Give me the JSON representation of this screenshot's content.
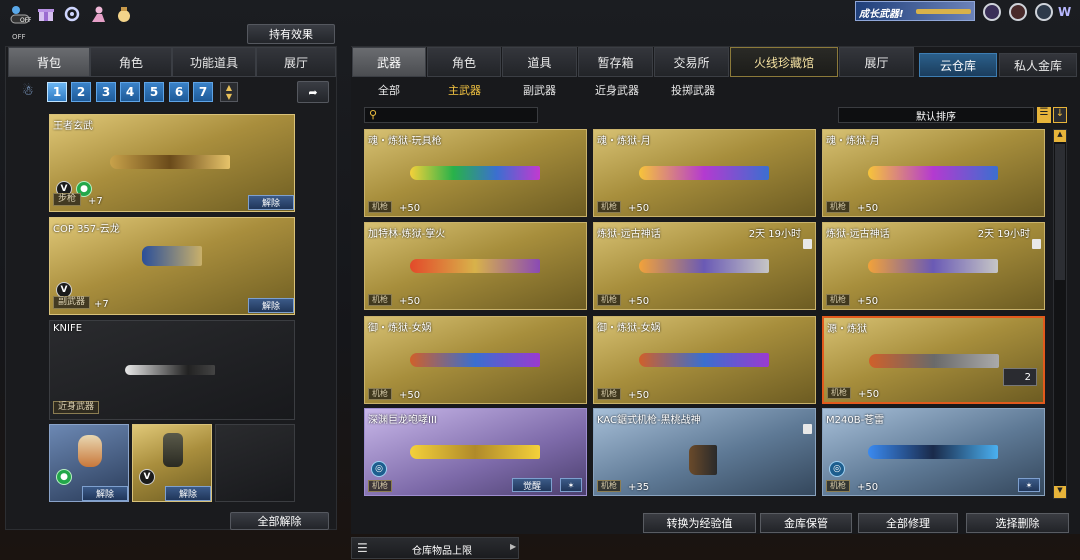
{
  "top_icons": [
    {
      "name": "off-toggle-icon",
      "label": "OFF"
    },
    {
      "name": "gift-icon"
    },
    {
      "name": "refresh-icon"
    },
    {
      "name": "character-icon"
    },
    {
      "name": "bag-icon"
    }
  ],
  "hold_effect_button": "持有效果",
  "top_right": {
    "banner": "成长武器!"
  },
  "left_tabs": [
    "背包",
    "角色",
    "功能道具",
    "展厅"
  ],
  "pages": [
    "1",
    "2",
    "3",
    "4",
    "5",
    "6",
    "7"
  ],
  "left_cards": [
    {
      "title": "王者玄武",
      "category": "步枪",
      "plus": "+7",
      "action": "解除"
    },
    {
      "title": "COP 357-云龙",
      "category": "副武器",
      "plus": "+7",
      "action": "解除"
    },
    {
      "title": "KNIFE",
      "category": "近身武器"
    }
  ],
  "grenade_cards": [
    {
      "action": "解除"
    },
    {
      "action": "解除"
    }
  ],
  "unequip_all": "全部解除",
  "right_tabs": [
    "武器",
    "角色",
    "道具",
    "暂存箱",
    "交易所",
    "火线珍藏馆",
    "展厅"
  ],
  "storage_tabs": [
    "云仓库",
    "私人金库"
  ],
  "sub_tabs": [
    "全部",
    "主武器",
    "副武器",
    "近身武器",
    "投掷武器"
  ],
  "sort_label": "默认排序",
  "grid": [
    {
      "title": "魂・炼狱-玩具枪",
      "category": "机枪",
      "plus": "+50",
      "time": ""
    },
    {
      "title": "魂・炼狱-月",
      "category": "机枪",
      "plus": "+50",
      "time": ""
    },
    {
      "title": "魂・炼狱-月",
      "category": "机枪",
      "plus": "+50",
      "time": ""
    },
    {
      "title": "加特林-炼狱-掌火",
      "category": "机枪",
      "plus": "+50",
      "time": ""
    },
    {
      "title": "炼狱-远古神话",
      "category": "机枪",
      "plus": "+50",
      "time": "2天 19小时"
    },
    {
      "title": "炼狱-远古神话",
      "category": "机枪",
      "plus": "+50",
      "time": "2天 19小时"
    },
    {
      "title": "御・炼狱-女娲",
      "category": "机枪",
      "plus": "+50",
      "time": ""
    },
    {
      "title": "御・炼狱-女娲",
      "category": "机枪",
      "plus": "+50",
      "time": ""
    },
    {
      "title": "源・炼狱",
      "category": "机枪",
      "plus": "+50",
      "time": "",
      "count": "2"
    },
    {
      "title": "深渊巨龙咆哮III",
      "category": "机枪",
      "plus": "",
      "time": "",
      "action1": "觉醒"
    },
    {
      "title": "KAC鋸式机枪-黑桃战神",
      "category": "机枪",
      "plus": "+35",
      "time": ""
    },
    {
      "title": "M240B-苍雷",
      "category": "机枪",
      "plus": "+50",
      "time": ""
    }
  ],
  "bottom_buttons": [
    "转换为经验值",
    "金库保管",
    "全部修理",
    "选择删除"
  ],
  "capacity_label": "仓库物品上限"
}
